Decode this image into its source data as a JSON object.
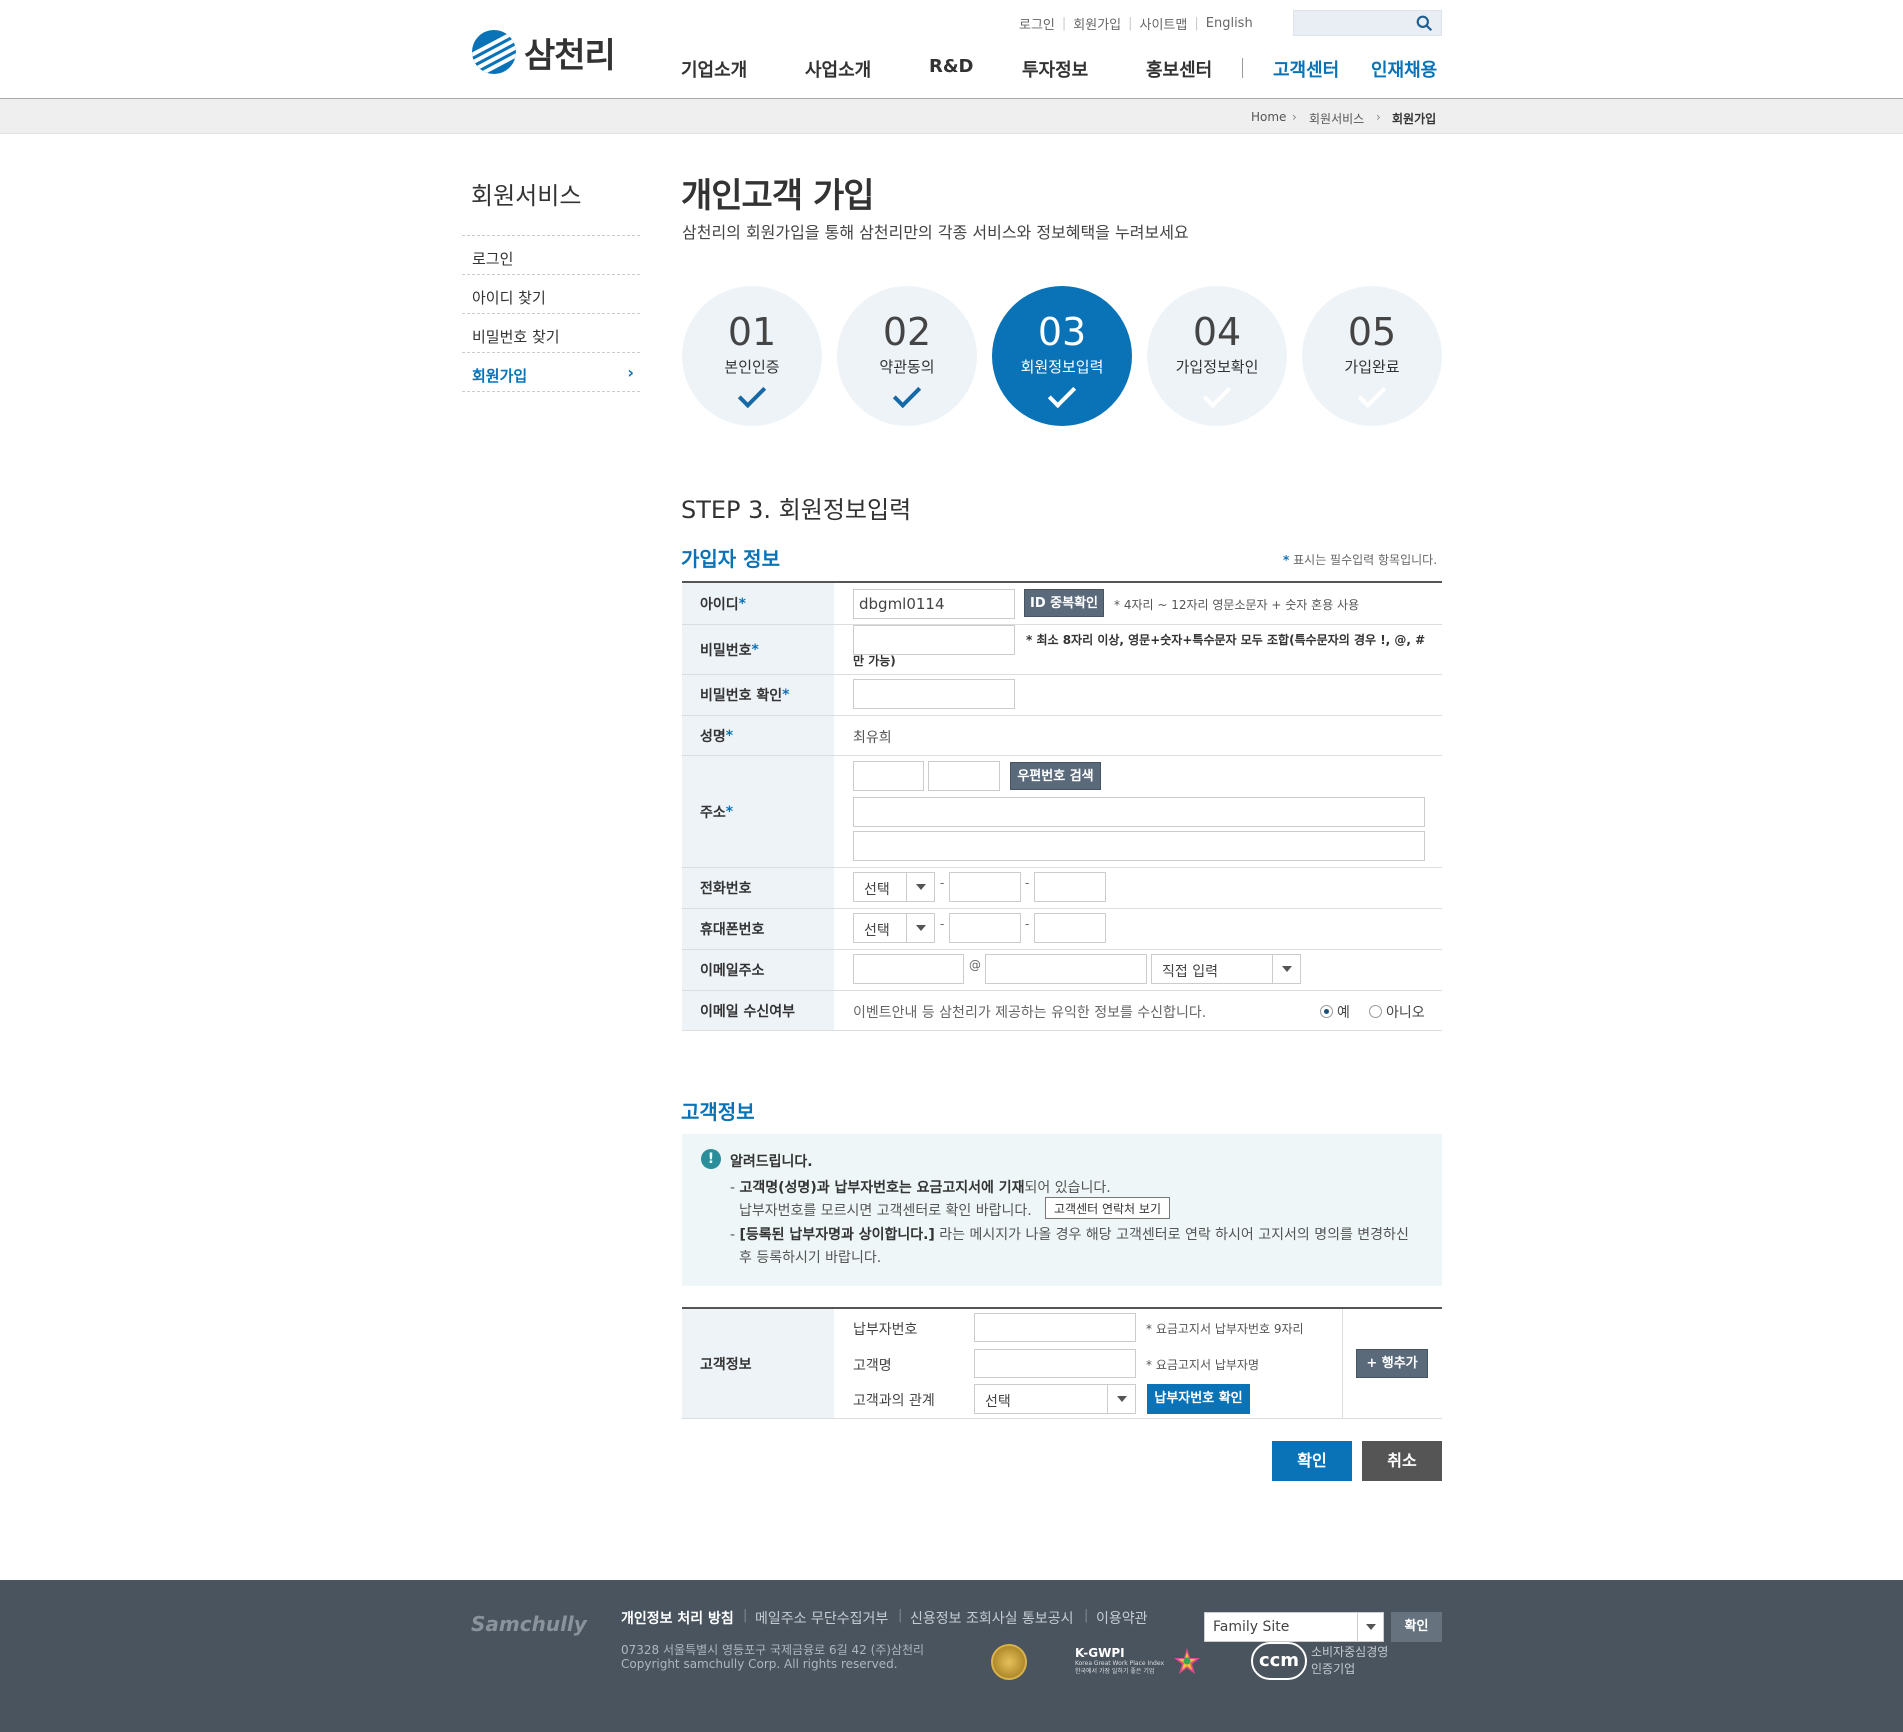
{
  "header": {
    "logo_text": "삼천리",
    "util_links": [
      "로그인",
      "회원가입",
      "사이트맵",
      "English"
    ],
    "nav": [
      "기업소개",
      "사업소개",
      "R&D",
      "투자정보",
      "홍보센터",
      "고객센터",
      "인재채용"
    ]
  },
  "breadcrumb": [
    "Home",
    "회원서비스",
    "회원가입"
  ],
  "sidebar": {
    "title": "회원서비스",
    "items": [
      "로그인",
      "아이디 찾기",
      "비밀번호 찾기",
      "회원가입"
    ]
  },
  "page": {
    "title": "개인고객 가입",
    "subtitle": "삼천리의 회원가입을 통해 삼천리만의 각종 서비스와 정보혜택을 누려보세요"
  },
  "steps": [
    {
      "num": "01",
      "label": "본인인증"
    },
    {
      "num": "02",
      "label": "약관동의"
    },
    {
      "num": "03",
      "label": "회원정보입력"
    },
    {
      "num": "04",
      "label": "가입정보확인"
    },
    {
      "num": "05",
      "label": "가입완료"
    }
  ],
  "step_heading": "STEP 3. 회원정보입력",
  "member": {
    "title": "가입자 정보",
    "required_note_star": "*",
    "required_note": "표시는 필수입력 항목입니다.",
    "star": "*",
    "labels": {
      "id": "아이디",
      "pw": "비밀번호",
      "pw_confirm": "비밀번호 확인",
      "name": "성명",
      "address": "주소",
      "phone": "전화번호",
      "mobile": "휴대폰번호",
      "email": "이메일주소",
      "email_opt": "이메일 수신여부"
    },
    "id_value": "dbgml0114",
    "id_check_btn": "ID 중복확인",
    "id_hint": "* 4자리 ~ 12자리 영문소문자 + 숫자 혼용 사용",
    "pw_hint": "* 최소 8자리 이상, 영문+숫자+특수문자 모두 조합(특수문자의 경우 !, @, # 만 가능)",
    "name_value": "최유희",
    "zip_btn": "우편번호 검색",
    "select_default": "선택",
    "dash": "-",
    "at": "@",
    "email_domain_select": "직접 입력",
    "email_opt_text": "이벤트안내 등 삼천리가 제공하는 유익한 정보를 수신합니다.",
    "radio_yes": "예",
    "radio_no": "아니오"
  },
  "customer": {
    "title": "고객정보",
    "notice_title": "알려드립니다.",
    "notice_l1_bold": "고객명(성명)과 납부자번호는 요금고지서에 기재",
    "notice_l1_rest": "되어 있습니다.",
    "notice_l2": "납부자번호를 모르시면 고객센터로 확인 바랍니다.",
    "contact_btn": "고객센터 연락처 보기",
    "notice_l3_bold": "[등록된 납부자명과 상이합니다.]",
    "notice_l3_rest": "라는 메시지가 나올 경우 해당 고객센터로 연락 하시어 고지서의 명의를 변경하신",
    "notice_l4": "후 등록하시기 바랍니다.",
    "row_label": "고객정보",
    "field_payer_no": "납부자번호",
    "field_name": "고객명",
    "field_relation": "고객과의 관계",
    "hint_payer": "* 요금고지서 납부자번호 9자리",
    "hint_name": "* 요금고지서 납부자명",
    "relation_select": "선택",
    "verify_btn": "납부자번호 확인",
    "add_row_btn": "+ 행추가"
  },
  "actions": {
    "confirm": "확인",
    "cancel": "취소"
  },
  "footer": {
    "logo": "Samchully",
    "links": [
      "개인정보 처리 방침",
      "메일주소 무단수집거부",
      "신용정보 조회사실 통보공시",
      "이용약관"
    ],
    "address": "07328 서울특별시 영등포구 국제금융로 6길 42 (주)삼천리",
    "copyright": "Copyright samchully Corp. All rights reserved.",
    "family_site": "Family Site",
    "family_btn": "확인",
    "kgwp": "K-GWPI",
    "kgwp_sub1": "Korea Great Work Place Index",
    "kgwp_sub2": "한국에서 가장 일하기 좋은 기업",
    "ccm": "ccm",
    "ccm_text1": "소비자중심경영",
    "ccm_text2": "인증기업"
  },
  "colors": {
    "brand": "#0a73b7",
    "footer": "#4a545f",
    "step_bg": "#eef3f8"
  }
}
